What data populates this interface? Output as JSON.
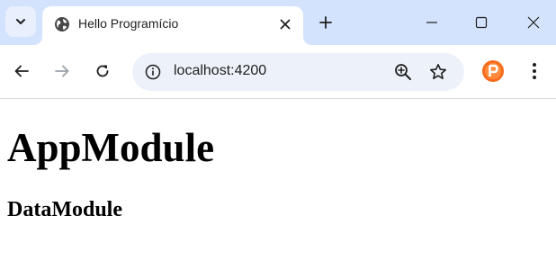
{
  "browser": {
    "tab": {
      "title": "Hello Programício",
      "favicon": "globe-icon"
    },
    "address_bar": {
      "url": "localhost:4200"
    },
    "icons": {
      "tab_search": "chevron-down-icon",
      "tab_close": "close-icon",
      "new_tab": "plus-icon",
      "minimize": "minimize-icon",
      "maximize": "maximize-icon",
      "close_window": "close-icon",
      "back": "arrow-left-icon",
      "forward": "arrow-right-icon",
      "reload": "reload-icon",
      "site_info": "info-icon",
      "zoom": "zoom-in-icon",
      "bookmark": "star-icon",
      "extension": "extension-p-icon",
      "menu": "more-vertical-icon"
    },
    "colors": {
      "title_bar": "#d3e3fd",
      "omnibox": "#edf2fa",
      "extension_badge": "#f76b1c"
    }
  },
  "page": {
    "heading": "AppModule",
    "subheading": "DataModule"
  }
}
